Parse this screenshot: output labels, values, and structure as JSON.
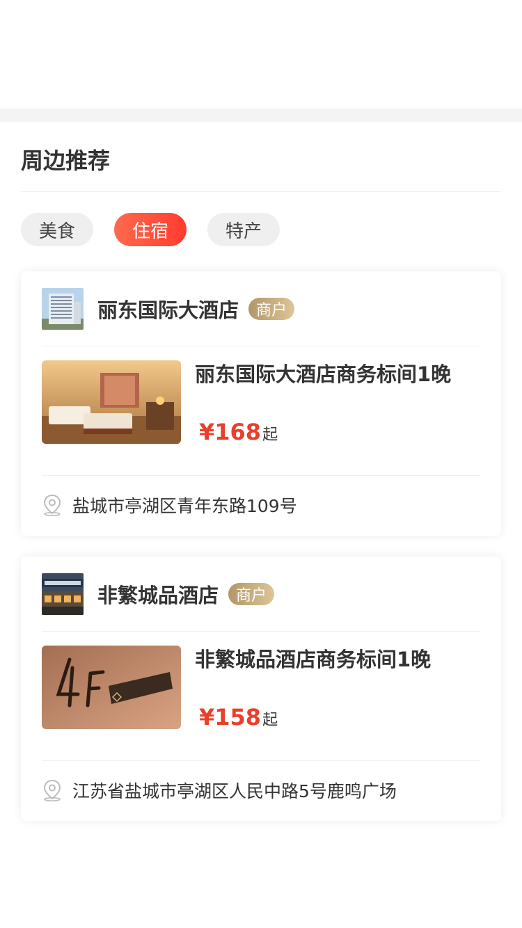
{
  "section": {
    "title": "周边推荐"
  },
  "tabs": [
    {
      "label": "美食",
      "active": false
    },
    {
      "label": "住宿",
      "active": true
    },
    {
      "label": "特产",
      "active": false
    }
  ],
  "cards": [
    {
      "store_name": "丽东国际大酒店",
      "badge": "商户",
      "product_title": "丽东国际大酒店商务标间1晚",
      "price": "¥168",
      "price_suffix": "起",
      "address": "盐城市亭湖区青年东路109号"
    },
    {
      "store_name": "非繁城品酒店",
      "badge": "商户",
      "product_title": "非繁城品酒店商务标间1晚",
      "price": "¥158",
      "price_suffix": "起",
      "address": "江苏省盐城市亭湖区人民中路5号鹿鸣广场"
    }
  ],
  "icons": {
    "location": "location-pin-icon"
  },
  "colors": {
    "accent": "#ff3b30",
    "price": "#e8402b",
    "badge_gold": "#c3a877"
  }
}
